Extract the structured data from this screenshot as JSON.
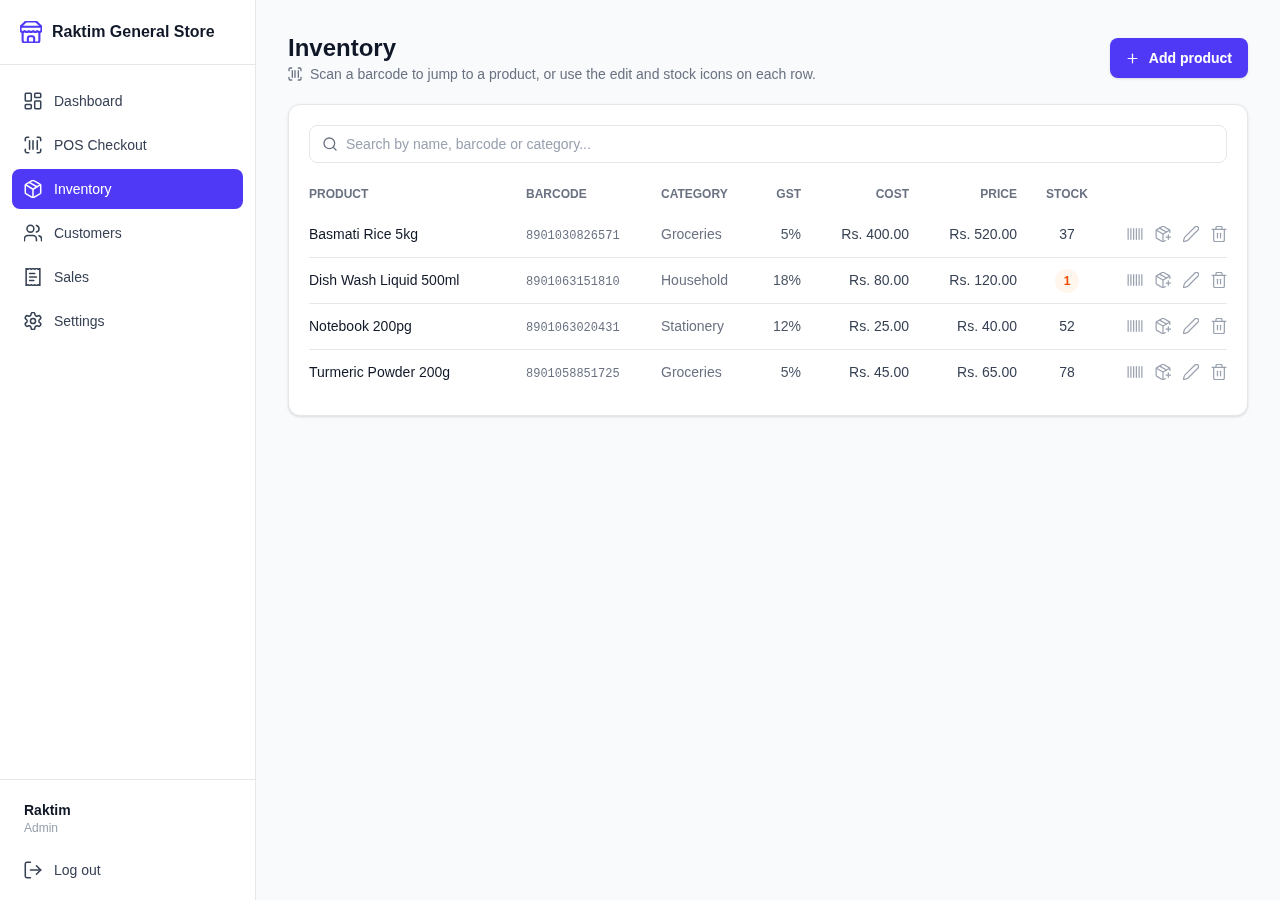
{
  "sidebar": {
    "brand": "Raktim General Store",
    "items": [
      {
        "label": "Dashboard",
        "selected": false
      },
      {
        "label": "POS Checkout",
        "selected": false
      },
      {
        "label": "Inventory",
        "selected": true
      },
      {
        "label": "Customers",
        "selected": false
      },
      {
        "label": "Sales",
        "selected": false
      },
      {
        "label": "Settings",
        "selected": false
      }
    ],
    "user": {
      "name": "Raktim",
      "role": "Admin"
    },
    "logout": "Log out"
  },
  "header": {
    "title": "Inventory",
    "subtitle": "Scan a barcode to jump to a product, or use the edit and stock icons on each row.",
    "add_button": "Add product"
  },
  "search": {
    "placeholder": "Search by name, barcode or category..."
  },
  "table": {
    "columns": [
      "PRODUCT",
      "BARCODE",
      "CATEGORY",
      "GST",
      "COST",
      "PRICE",
      "STOCK"
    ],
    "rows": [
      {
        "product": "Basmati Rice 5kg",
        "barcode": "8901030826571",
        "category": "Groceries",
        "gst": "5%",
        "cost": "Rs. 400.00",
        "price": "Rs. 520.00",
        "stock": "37",
        "low_stock": false
      },
      {
        "product": "Dish Wash Liquid 500ml",
        "barcode": "8901063151810",
        "category": "Household",
        "gst": "18%",
        "cost": "Rs. 80.00",
        "price": "Rs. 120.00",
        "stock": "1",
        "low_stock": true
      },
      {
        "product": "Notebook 200pg",
        "barcode": "8901063020431",
        "category": "Stationery",
        "gst": "12%",
        "cost": "Rs. 25.00",
        "price": "Rs. 40.00",
        "stock": "52",
        "low_stock": false
      },
      {
        "product": "Turmeric Powder 200g",
        "barcode": "8901058851725",
        "category": "Groceries",
        "gst": "5%",
        "cost": "Rs. 45.00",
        "price": "Rs. 65.00",
        "stock": "78",
        "low_stock": false
      }
    ]
  }
}
